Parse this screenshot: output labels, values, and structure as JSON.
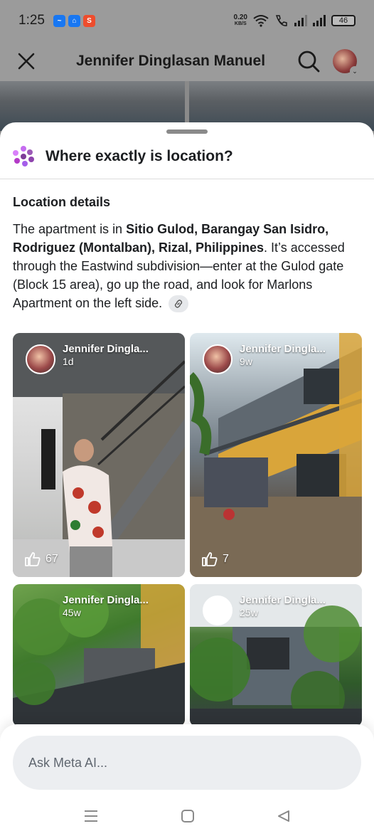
{
  "status_bar": {
    "time": "1:25",
    "net_speed_value": "0.20",
    "net_speed_unit": "KB/S",
    "battery": "46",
    "app_icons": [
      "messenger-icon",
      "home-app-icon",
      "shopee-icon"
    ]
  },
  "header": {
    "title": "Jennifer Dinglasan Manuel",
    "close_icon": "close-icon",
    "search_icon": "search-icon"
  },
  "sheet": {
    "title": "Where exactly is location?",
    "section_title": "Location details",
    "body": {
      "p1": "The apartment is in ",
      "bold1": "Sitio Gulod, Barangay San Isidro, Rodriguez (Montalban), Rizal, Philippines",
      "p2": ". It’s accessed through the Eastwind subdivision—enter at the Gulod gate (Block 15 area), go up the road, and look for Marlons Apartment on the left side."
    }
  },
  "posts": [
    {
      "author": "Jennifer Dingla...",
      "time": "1d",
      "likes": "67"
    },
    {
      "author": "Jennifer Dingla...",
      "time": "9w",
      "likes": "7"
    },
    {
      "author": "Jennifer Dingla...",
      "time": "45w",
      "likes": ""
    },
    {
      "author": "Jennifer Dingla...",
      "time": "25w",
      "likes": ""
    }
  ],
  "ask": {
    "placeholder": "Ask Meta AI..."
  },
  "colors": {
    "meta_ai_accent": "#8e44ad",
    "overlay_gray": "#9b9b9b"
  }
}
